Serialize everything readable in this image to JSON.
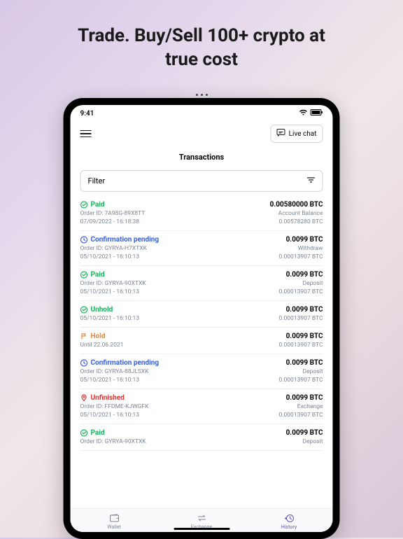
{
  "headline_line1": "Trade. Buy/Sell 100+ crypto at",
  "headline_line2": "true cost",
  "status_time": "9:41",
  "topbar": {
    "live_chat": "Live chat"
  },
  "page_title": "Transactions",
  "filter_label": "Filter",
  "transactions": [
    {
      "status": "Paid",
      "status_class": "status-green",
      "icon": "check",
      "amount": "0.00580000 BTC",
      "line2_left": "Order ID: 7A98G-89X8TT",
      "line2_right": "Account Balance",
      "line3_left": "07/09/2022 - 16:18:38",
      "line3_right": "0.00578280 BTC"
    },
    {
      "status": "Confirmation pending",
      "status_class": "status-blue",
      "icon": "clock",
      "amount": "0.0099 BTC",
      "line2_left": "Order ID: GYRYA-H7XTXK",
      "line2_right": "Withdraw",
      "line3_left": "05/10/2021 - 16:10:13",
      "line3_right": "0.00013907 BTC"
    },
    {
      "status": "Paid",
      "status_class": "status-green",
      "icon": "check",
      "amount": "0.0099 BTC",
      "line2_left": "Order ID: GYRYA-90XTXK",
      "line2_right": "Deposit",
      "line3_left": "05/10/2021 - 16:10:13",
      "line3_right": "0.00013907 BTC"
    },
    {
      "status": "Unhold",
      "status_class": "status-green",
      "icon": "check",
      "amount": "0.0099 BTC",
      "line2_left": "05/10/2021 - 16:10:13",
      "line2_right": "0.00013907 BTC",
      "line3_left": "",
      "line3_right": ""
    },
    {
      "status": "Hold",
      "status_class": "status-orange",
      "icon": "flag",
      "amount": "0.0099 BTC",
      "line2_left": "Until 22.06.2021",
      "line2_right": "0.00013907 BTC",
      "line3_left": "",
      "line3_right": ""
    },
    {
      "status": "Confirmation pending",
      "status_class": "status-blue",
      "icon": "clock",
      "amount": "0.0099 BTC",
      "line2_left": "Order ID: GYRYA-88JLSXK",
      "line2_right": "Deposit",
      "line3_left": "05/10/2021 - 16:10:13",
      "line3_right": "0.00013907 BTC"
    },
    {
      "status": "Unfinished",
      "status_class": "status-red",
      "icon": "pin",
      "amount": "0.0099 BTC",
      "line2_left": "Order ID: FFDME-KJWGFK",
      "line2_right": "Exchange",
      "line3_left": "05/10/2021 - 16:10:13",
      "line3_right": "0.00013907 BTC"
    },
    {
      "status": "Paid",
      "status_class": "status-green",
      "icon": "check",
      "amount": "0.0099 BTC",
      "line2_left": "Order ID: GYRYA-90XTXK",
      "line2_right": "Deposit",
      "line3_left": "",
      "line3_right": ""
    }
  ],
  "nav": {
    "wallet": "Wallet",
    "exchange": "Exchange",
    "history": "History"
  }
}
